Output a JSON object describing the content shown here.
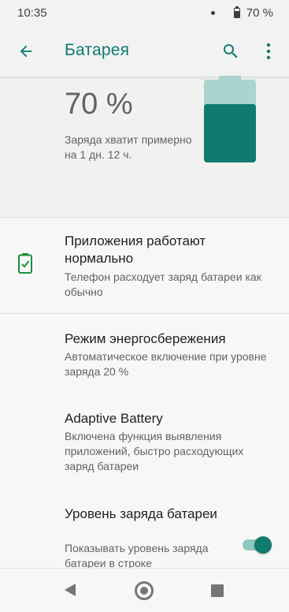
{
  "status_bar": {
    "time": "10:35",
    "battery_text": "70 %",
    "battery_level": 0.7
  },
  "app_bar": {
    "title": "Батарея",
    "back_icon": "arrow-back-icon",
    "search_icon": "search-icon",
    "more_icon": "more-vert-icon"
  },
  "battery_header": {
    "percent": "70 %",
    "estimate": "Заряда хватит примерно на 1 дн. 12 ч.",
    "level": 0.7
  },
  "items": {
    "status": {
      "title": "Приложения работают нормально",
      "summary": "Телефон расходует заряд батареи как обычно",
      "icon": "battery-check-icon"
    },
    "power_saver": {
      "title": "Режим энергосбережения",
      "summary": "Автоматическое включение при уровне заряда 20 %"
    },
    "adaptive_battery": {
      "title": "Adaptive Battery",
      "summary": "Включена функция выявления приложений, быстро расходующих заряд батареи"
    },
    "battery_percentage": {
      "title": "Уровень заряда батареи",
      "summary": "Показывать уровень заряда батареи в строке",
      "toggle_on": true
    }
  },
  "colors": {
    "accent": "#0f7a6e",
    "accent_light": "#8fc7bf",
    "battery_empty": "#a8d5cf",
    "icon_green": "#1e8e3e"
  },
  "nav_bar": {
    "back_icon": "nav-back-icon",
    "home_icon": "nav-home-icon",
    "recents_icon": "nav-recents-icon"
  }
}
